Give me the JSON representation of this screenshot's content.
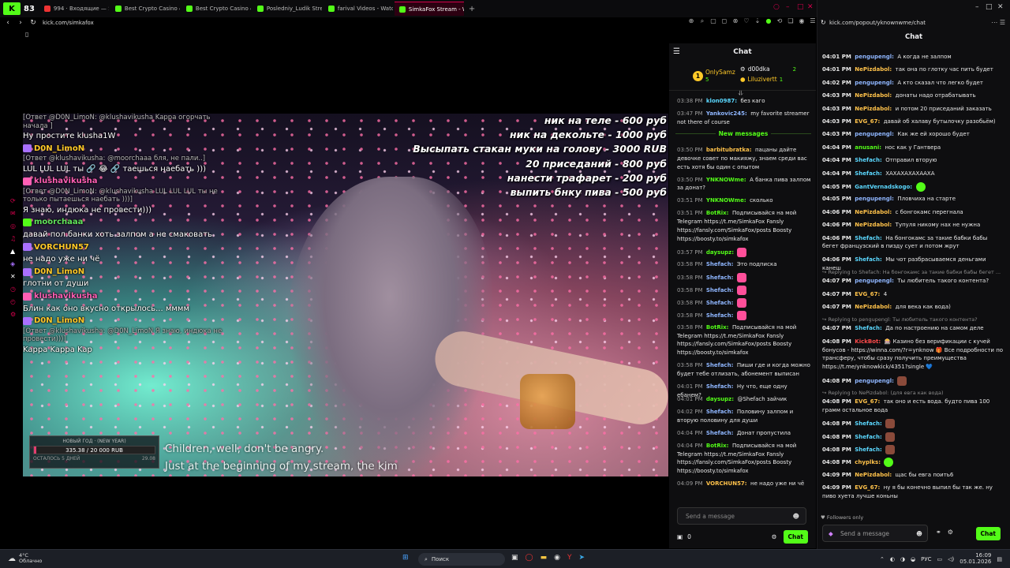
{
  "browser": {
    "tab_count": "83",
    "tabs": [
      {
        "title": "994 · Входящие — Яндек",
        "color": "#e33"
      },
      {
        "title": "Best Crypto Casino & Bitc",
        "color": "#53fc18"
      },
      {
        "title": "Best Crypto Casino & Bitc",
        "color": "#53fc18"
      },
      {
        "title": "Posledniy_Ludik Stream -",
        "color": "#53fc18"
      },
      {
        "title": "farival Videos - Watch On",
        "color": "#53fc18"
      },
      {
        "title": "SimkaFox Stream - Wa",
        "color": "#53fc18"
      }
    ],
    "url": "kick.com/simkafox",
    "popout_url": "kick.com/popout/yknownwme/chat"
  },
  "video_chat": [
    {
      "type": "reply",
      "text": "[Ответ @D0N_LimoN: @klushavikusha Kappa огорчать начала ]"
    },
    {
      "type": "msg",
      "text": "Ну простите klusha1W"
    },
    {
      "type": "name",
      "text": "D0N_LimoN",
      "color": "gold"
    },
    {
      "type": "reply",
      "text": "[Ответ @klushavikusha: @moorchaaa бля, не пали..]"
    },
    {
      "type": "msg",
      "text": "LUL LUL LUL ты 🔗 😂 🔗 таешься наебать )))"
    },
    {
      "type": "name",
      "text": "klushavikusha",
      "color": "pink"
    },
    {
      "type": "reply",
      "text": "[Ответ @D0N_LimoN: @klushavikusha LUL LUL LUL ты не только пытаешься наебать )))]"
    },
    {
      "type": "msg",
      "text": "Я знаю, индюка не провести)))"
    },
    {
      "type": "name",
      "text": "moorchaaa",
      "color": "green"
    },
    {
      "type": "msg",
      "text": "давай пол банки хоть залпом а не смаковать"
    },
    {
      "type": "name",
      "text": "VORCHUN57",
      "color": "gold"
    },
    {
      "type": "msg",
      "text": "не надо уже ни чё"
    },
    {
      "type": "name",
      "text": "D0N_LimoN",
      "color": "gold"
    },
    {
      "type": "msg",
      "text": "глотни от души"
    },
    {
      "type": "name",
      "text": "klushavikusha",
      "color": "pink"
    },
    {
      "type": "msg",
      "text": "Блин как оно вкусно открылось... мммм"
    },
    {
      "type": "name",
      "text": "D0N_LimoN",
      "color": "gold"
    },
    {
      "type": "reply",
      "text": "[Ответ @klushavikusha: @D0N_LimoN Я знаю, индюка не провести)))]"
    },
    {
      "type": "msg",
      "text": "Kappa Kappa Kap"
    }
  ],
  "prices": [
    "ник на теле - 600 руб",
    "ник на декольте - 1000 руб",
    "Высыпать стакан муки на голову - 3000 RUB",
    "20 приседаний - 800 руб",
    "нанести трафарет - 200 руб",
    "выпить бнку пива - 500 руб"
  ],
  "goal": {
    "title": "НОВЫЙ ГОД  ·  (NEW YEAR)",
    "amount": "335.38 / 20 000 RUB",
    "progress": 0.017,
    "left": "ОСТАЛОСЬ 5 ДНЕЙ",
    "right": "29.08"
  },
  "subtitles": [
    "Children, well, don't be angry.",
    "Just at the beginning of my stream, the kim"
  ],
  "chat1": {
    "title": "Chat",
    "leaderboard": [
      {
        "name": "OnlySamz",
        "count": "5",
        "rank": "1"
      },
      {
        "name": "d00dka",
        "count": "2"
      },
      {
        "name": "Liluzivertt",
        "count": "1"
      }
    ],
    "new_messages": "New messages",
    "messages": [
      {
        "time": "03:38 PM",
        "user": "klon0987:",
        "color": "#5bd8ff",
        "text": "без кaго"
      },
      {
        "time": "03:47 PM",
        "user": "Yankovic245:",
        "color": "#8fb6ff",
        "text": "my favorite streamer not there of course"
      },
      {
        "time": "03:50 PM",
        "user": "barbitubratka:",
        "color": "#ffc24a",
        "text": "пацаны дайте девочке совет по макияжу, знаем среди вас есть хотя бы один с опытом"
      },
      {
        "time": "03:50 PM",
        "user": "YNKNOWme:",
        "color": "#53fc18",
        "text": "А банка пива залпом за донат?"
      },
      {
        "time": "03:51 PM",
        "user": "YNKNOWme:",
        "color": "#53fc18",
        "text": "сколько"
      },
      {
        "time": "03:51 PM",
        "user": "BotRix:",
        "color": "#53fc18",
        "text": "Подписывайся на мой Telegram https://t.me/SimkaFox Fansly https://fansly.com/SimkaFox/posts Boosty https://boosty.to/simkafox"
      },
      {
        "time": "03:57 PM",
        "user": "daysupz:",
        "color": "#53fc18",
        "text": "💗"
      },
      {
        "time": "03:58 PM",
        "user": "Shefach:",
        "color": "#8fb6ff",
        "text": "Это подписка"
      },
      {
        "time": "03:58 PM",
        "user": "Shefach:",
        "color": "#8fb6ff",
        "text": "💗"
      },
      {
        "time": "03:58 PM",
        "user": "Shefach:",
        "color": "#8fb6ff",
        "text": "💗"
      },
      {
        "time": "03:58 PM",
        "user": "Shefach:",
        "color": "#8fb6ff",
        "text": "💗"
      },
      {
        "time": "03:58 PM",
        "user": "Shefach:",
        "color": "#8fb6ff",
        "text": "💗"
      },
      {
        "time": "03:58 PM",
        "user": "BotRix:",
        "color": "#53fc18",
        "text": "Подписывайся на мой Telegram https://t.me/SimkaFox Fansly https://fansly.com/SimkaFox/posts Boosty https://boosty.to/simkafox"
      },
      {
        "time": "03:58 PM",
        "user": "Shefach:",
        "color": "#8fb6ff",
        "text": "Пиши где и когда можно будет тебе отлизать, абонемент выписан"
      },
      {
        "time": "04:01 PM",
        "user": "Shefach:",
        "color": "#8fb6ff",
        "text": "Ну что, еще одну ебанем?"
      },
      {
        "time": "04:01 PM",
        "user": "daysupz:",
        "color": "#53fc18",
        "text": "@Shefach зайчик"
      },
      {
        "time": "04:02 PM",
        "user": "Shefach:",
        "color": "#8fb6ff",
        "text": "Половину залпом и вторую половину для души"
      },
      {
        "time": "04:04 PM",
        "user": "Shefach:",
        "color": "#8fb6ff",
        "text": "Донат пропустила"
      },
      {
        "time": "04:04 PM",
        "user": "BotRix:",
        "color": "#53fc18",
        "text": "Подписывайся на мой Telegram https://t.me/SimkaFox Fansly https://fansly.com/SimkaFox/posts Boosty https://boosty.to/simkafox"
      },
      {
        "time": "04:09 PM",
        "user": "VORCHUN57:",
        "color": "#ffc24a",
        "text": "не надо уже ни чё"
      }
    ],
    "input_placeholder": "Send a message",
    "points": "0",
    "chat_button": "Chat"
  },
  "chat2": {
    "title": "Chat",
    "messages": [
      {
        "time": "04:01 PM",
        "user": "pengupengl:",
        "color": "#8fb6ff",
        "text": "А когда не залпом"
      },
      {
        "time": "04:01 PM",
        "user": "NePizdabol:",
        "color": "#ffc24a",
        "text": "так она по глотку час пить будет"
      },
      {
        "time": "04:02 PM",
        "user": "pengupengl:",
        "color": "#8fb6ff",
        "text": "А кто сказал что легко будет"
      },
      {
        "time": "04:03 PM",
        "user": "NePizdabol:",
        "color": "#ffc24a",
        "text": "донаты надо отрабатывать"
      },
      {
        "time": "04:03 PM",
        "user": "NePizdabol:",
        "color": "#ffc24a",
        "text": "и потом 20 приседаний заказать"
      },
      {
        "time": "04:03 PM",
        "user": "EVG_67:",
        "color": "#ffc24a",
        "text": "давай об халаву бутылочку разобьём)"
      },
      {
        "time": "04:03 PM",
        "user": "pengupengl:",
        "color": "#8fb6ff",
        "text": "Как же ей хорошо будет"
      },
      {
        "time": "04:04 PM",
        "user": "anusani:",
        "color": "#53fc18",
        "text": "нос как у Гантвера"
      },
      {
        "time": "04:04 PM",
        "user": "Shefach:",
        "color": "#5bd8ff",
        "text": "Отправил вторую"
      },
      {
        "time": "04:04 PM",
        "user": "Shefach:",
        "color": "#5bd8ff",
        "text": "ХАХАХАХАХААХА"
      },
      {
        "time": "04:05 PM",
        "user": "GantVernadskogo:",
        "color": "#5bd8ff",
        "text": "😊"
      },
      {
        "time": "04:05 PM",
        "user": "pengupengl:",
        "color": "#8fb6ff",
        "text": "Пловчиха на старте"
      },
      {
        "time": "04:06 PM",
        "user": "NePizdabol:",
        "color": "#ffc24a",
        "text": "с бонгокамс перегнала"
      },
      {
        "time": "04:06 PM",
        "user": "NePizdabol:",
        "color": "#ffc24a",
        "text": "Тупуля никому нах не нужна"
      },
      {
        "time": "04:06 PM",
        "user": "Shefach:",
        "color": "#5bd8ff",
        "text": "На бонгокамс за такие бабки бабы бегет французский в пизду сует и потом жрут"
      },
      {
        "time": "04:06 PM",
        "user": "Shefach:",
        "color": "#5bd8ff",
        "text": "Мы чот разбрасываемся деньгами канеш"
      },
      {
        "reply": "Replying to Shefach: На бонгокамс за такие бабки бабы бегет ..."
      },
      {
        "time": "04:07 PM",
        "user": "pengupengl:",
        "color": "#8fb6ff",
        "text": "Ты любитель такого контента?"
      },
      {
        "time": "04:07 PM",
        "user": "EVG_67:",
        "color": "#ffc24a",
        "text": "4"
      },
      {
        "time": "04:07 PM",
        "user": "NePizdabol:",
        "color": "#ffc24a",
        "text": "для века как вода)"
      },
      {
        "reply": "Replying to pengupengl: Ты любитель такого контента?"
      },
      {
        "time": "04:07 PM",
        "user": "Shefach:",
        "color": "#5bd8ff",
        "text": "Да по настроению на самом деле"
      },
      {
        "time": "04:08 PM",
        "user": "KickBot:",
        "color": "#ff4a4a",
        "text": "🎰 Казино без верификации с кучей бонусов - https://winna.com/?r=ynknow 🎁 Все подробности по трансферу, чтобы сразу получить преимущества https://t.me/ynknowkick/4351?single 💙"
      },
      {
        "time": "04:08 PM",
        "user": "pengupengl:",
        "color": "#8fb6ff",
        "text": "🟫"
      },
      {
        "reply": "Replying to NePizdabol: (для евга как вода)"
      },
      {
        "time": "04:08 PM",
        "user": "EVG_67:",
        "color": "#ffc24a",
        "text": "так оно и есть вода. будто пива 100 грамм остальное вода"
      },
      {
        "time": "04:08 PM",
        "user": "Shefach:",
        "color": "#5bd8ff",
        "text": "🟫"
      },
      {
        "time": "04:08 PM",
        "user": "Shefach:",
        "color": "#5bd8ff",
        "text": "🟫"
      },
      {
        "time": "04:08 PM",
        "user": "Shefach:",
        "color": "#5bd8ff",
        "text": "🟫"
      },
      {
        "time": "04:08 PM",
        "user": "chyplks:",
        "color": "#ffc24a",
        "text": "😊"
      },
      {
        "time": "04:09 PM",
        "user": "NePizdabol:",
        "color": "#ffc24a",
        "text": "щас бы евга поить6"
      },
      {
        "time": "04:09 PM",
        "user": "EVG_67:",
        "color": "#ffc24a",
        "text": "ну я бы конечно выпил бы так же. ну пиво хуета лучше коньны"
      }
    ],
    "followers_only": "Followers only",
    "input_placeholder": "Send a message",
    "chat_button": "Chat"
  },
  "taskbar": {
    "temp": "4°C",
    "weather": "Облачно",
    "search": "Поиск",
    "lang": "РУС",
    "time": "16:09",
    "date": "05.01.2026"
  }
}
